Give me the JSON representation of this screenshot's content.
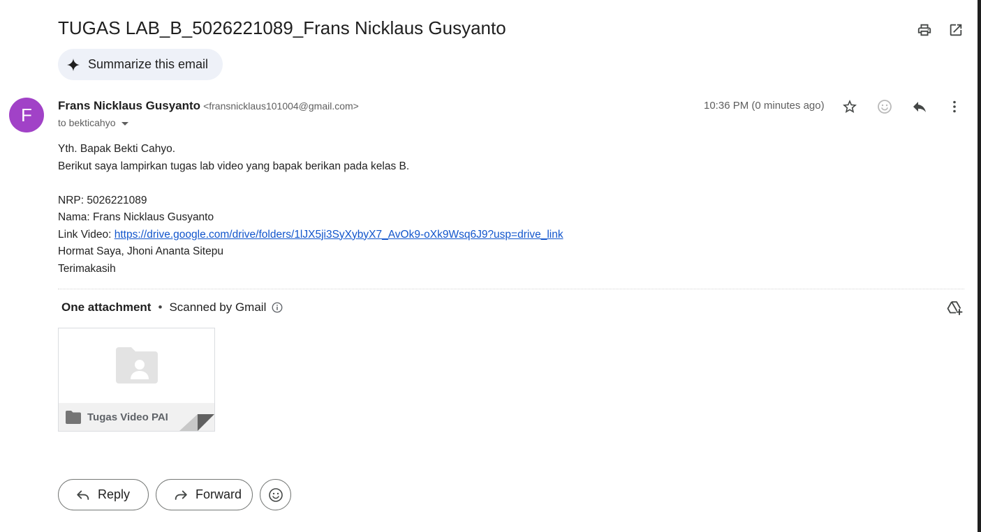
{
  "email": {
    "subject": "TUGAS LAB_B_5026221089_Frans Nicklaus Gusyanto",
    "summarize_label": "Summarize this email",
    "sender": {
      "avatar_letter": "F",
      "avatar_color": "#a142c7",
      "name": "Frans Nicklaus Gusyanto",
      "email": "<fransnicklaus101004@gmail.com>",
      "to": "to bekticahyo"
    },
    "time": "10:36 PM (0 minutes ago)",
    "body": {
      "line1": "Yth. Bapak Bekti Cahyo.",
      "line2": "Berikut saya lampirkan tugas lab video yang bapak berikan pada kelas B.",
      "nrp": "NRP: 5026221089",
      "nama": "Nama: Frans Nicklaus Gusyanto",
      "link_prefix": "Link Video: ",
      "link_text": "https://drive.google.com/drive/folders/1lJX5ji3SyXybyX7_AvOk9-oXk9Wsq6J9?usp=drive_link",
      "hormat": "Hormat Saya, Jhoni Ananta Sitepu",
      "closing": "Terimakasih"
    },
    "attachments": {
      "count_label": "One attachment",
      "separator": "•",
      "scanned_label": "Scanned by Gmail",
      "items": [
        {
          "name": "Tugas Video PAI",
          "icon": "shared-folder-icon"
        }
      ]
    },
    "actions": {
      "reply": "Reply",
      "forward": "Forward"
    },
    "icons": [
      "print-icon",
      "open-in-new-window-icon",
      "sparkle-icon",
      "star-icon",
      "emoji-icon",
      "reply-icon",
      "more-vert-icon",
      "info-icon",
      "add-to-drive-icon",
      "forward-icon"
    ],
    "colors": {
      "link": "#1155cc",
      "summarize_bg": "#eef1f8",
      "muted_text": "#5e5e5e"
    }
  }
}
